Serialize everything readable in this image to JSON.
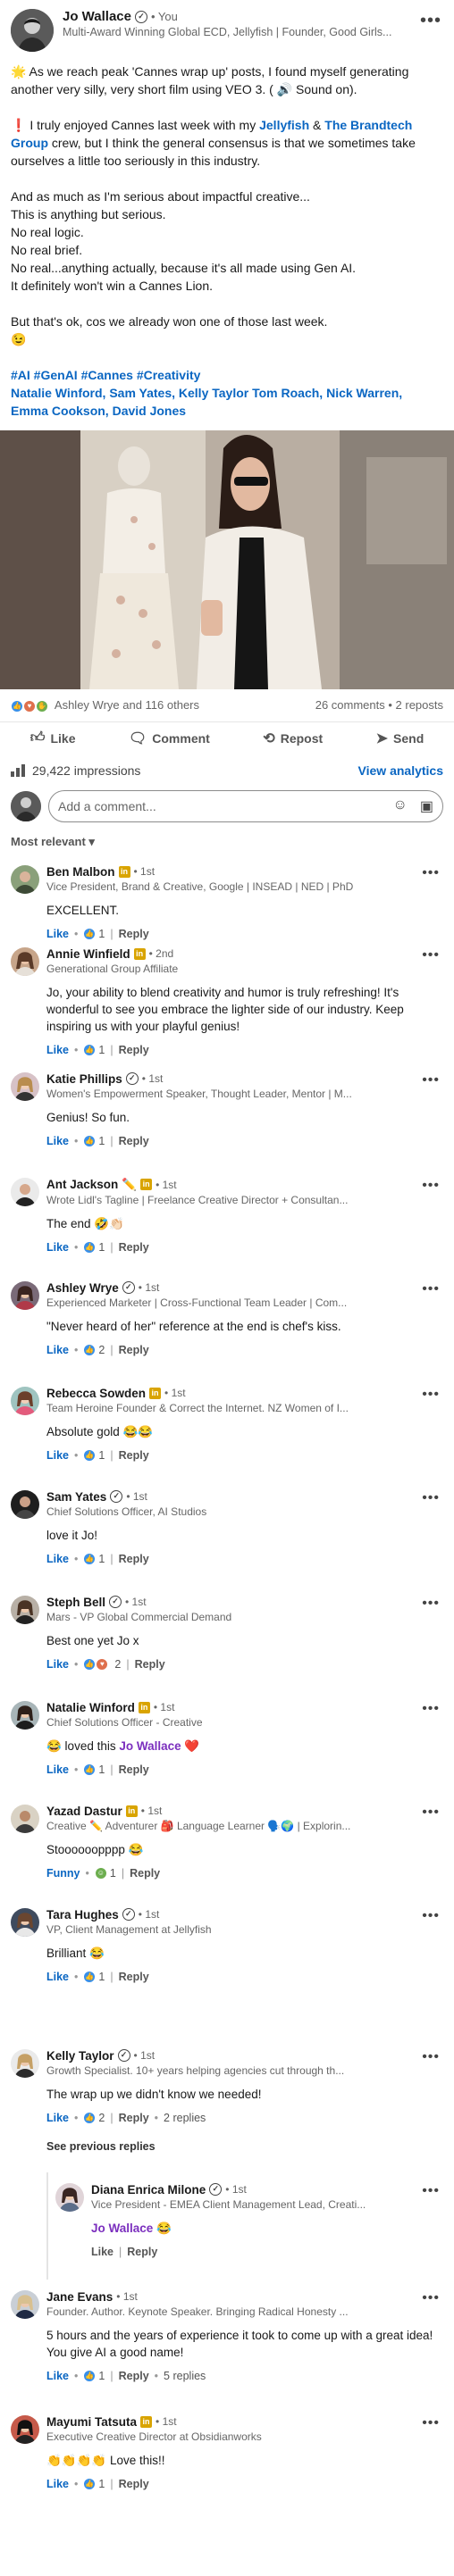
{
  "post": {
    "author_name": "Jo Wallace",
    "author_degree": "• You",
    "author_headline": "Multi-Award Winning Global ECD, Jellyfish | Founder, Good Girls...",
    "body": {
      "line1": "🌟 As we reach peak 'Cannes wrap up' posts, I found myself generating another very silly, very short film using VEO 3. ( 🔊 Sound on).",
      "line2_prefix": "❗ I truly enjoyed Cannes last week with my ",
      "link1": "Jellyfish",
      "amp": " & ",
      "link2": "The Brandtech Group",
      "line2_suffix": " crew, but I think the general consensus is that we sometimes take ourselves a little too seriously in this industry.",
      "line3": "And as much as I'm serious about impactful creative...",
      "line4": "This is anything but serious.",
      "line5": "No real logic.",
      "line6": "No real brief.",
      "line7": "No real...anything actually, because it's all made using Gen AI.",
      "line8": "It definitely won't win a Cannes Lion.",
      "line9": "But that's ok, cos we already won one of those last week.",
      "line10": "😉",
      "hashtags": "#AI #GenAI #Cannes #Creativity",
      "tags": "Natalie Winford, Sam Yates, Kelly Taylor Tom Roach, Nick Warren, Emma Cookson, David Jones"
    },
    "reactions_text": "Ashley Wrye and 116 others",
    "comments_reposts": "26 comments • 2 reposts",
    "actions": {
      "like": "Like",
      "comment": "Comment",
      "repost": "Repost",
      "send": "Send"
    },
    "impressions": "29,422 impressions",
    "view_analytics": "View analytics",
    "comment_placeholder": "Add a comment...",
    "sort_label": "Most relevant ▾"
  },
  "comments": [
    {
      "name": "Ben Malbon",
      "degree": "• 1st",
      "headline": "Vice President, Brand & Creative, Google | INSEAD | NED | PhD",
      "text": "EXCELLENT.",
      "reaction": "Like",
      "count": "1",
      "reply": "Reply"
    },
    {
      "name": "Annie Winfield",
      "degree": "• 2nd",
      "headline": "Generational Group Affiliate",
      "text": "Jo, your ability to blend creativity and humor is truly refreshing! It's wonderful to see you embrace the lighter side of our industry. Keep inspiring us with your playful genius!",
      "reaction": "Like",
      "count": "1",
      "reply": "Reply"
    },
    {
      "name": "Katie Phillips",
      "degree": "• 1st",
      "headline": "Women's Empowerment Speaker, Thought Leader, Mentor | M...",
      "text": "Genius! So fun.",
      "reaction": "Like",
      "count": "1",
      "reply": "Reply"
    },
    {
      "name": "Ant Jackson",
      "degree": "• 1st",
      "headline": "Wrote Lidl's Tagline | Freelance Creative Director + Consultan...",
      "text": "The end 🤣👏🏻",
      "reaction": "Like",
      "count": "1",
      "reply": "Reply"
    },
    {
      "name": "Ashley Wrye",
      "degree": "• 1st",
      "headline": "Experienced Marketer | Cross-Functional Team Leader | Com...",
      "text": "\"Never heard of her\" reference at the end is chef's kiss.",
      "reaction": "Like",
      "count": "2",
      "reply": "Reply"
    },
    {
      "name": "Rebecca Sowden",
      "degree": "• 1st",
      "headline": "Team Heroine Founder & Correct the Internet. NZ Women of I...",
      "text": "Absolute gold 😂😂",
      "reaction": "Like",
      "count": "1",
      "reply": "Reply"
    },
    {
      "name": "Sam Yates",
      "degree": "• 1st",
      "headline": "Chief Solutions Officer, AI Studios",
      "text": "love it Jo!",
      "reaction": "Like",
      "count": "1",
      "reply": "Reply"
    },
    {
      "name": "Steph Bell",
      "degree": "• 1st",
      "headline": "Mars - VP Global Commercial Demand",
      "text": "Best one yet Jo x",
      "reaction": "Like",
      "count": "2",
      "reply": "Reply"
    },
    {
      "name": "Natalie Winford",
      "degree": "• 1st",
      "headline": "Chief Solutions Officer - Creative",
      "text_prefix": "😂 loved this ",
      "mention": "Jo Wallace",
      "text_suffix": " ❤️",
      "reaction": "Like",
      "count": "1",
      "reply": "Reply"
    },
    {
      "name": "Yazad Dastur",
      "degree": "• 1st",
      "headline": "Creative ✏️ Adventurer 🎒 Language Learner 🗣️🌍 | Explorin...",
      "text": "Stoooooopppp 😂",
      "reaction": "Funny",
      "count": "1",
      "reply": "Reply"
    },
    {
      "name": "Tara Hughes",
      "degree": "• 1st",
      "headline": "VP, Client Management at Jellyfish",
      "text": "Brilliant 😂",
      "reaction": "Like",
      "count": "1",
      "reply": "Reply"
    },
    {
      "name": "Kelly Taylor",
      "degree": "• 1st",
      "headline": "Growth Specialist. 10+ years helping agencies cut through th...",
      "text": "The wrap up we didn't know we needed!",
      "reaction": "Like",
      "count": "2",
      "reply": "Reply",
      "replies_count": "2 replies",
      "see_previous": "See previous replies"
    },
    {
      "name": "Diana Enrica Milone",
      "degree": "• 1st",
      "headline": "Vice President - EMEA Client Management Lead, Creati...",
      "mention": "Jo Wallace",
      "text_suffix": " 😂",
      "reaction": "Like",
      "reply": "Reply"
    },
    {
      "name": "Jane Evans",
      "degree": "• 1st",
      "headline": "Founder. Author. Keynote Speaker. Bringing Radical Honesty ...",
      "text": "5 hours and the years of experience it took to come up with a great idea! You give AI a good name!",
      "reaction": "Like",
      "count": "1",
      "reply": "Reply",
      "replies_count": "5 replies"
    },
    {
      "name": "Mayumi Tatsuta",
      "degree": "• 1st",
      "headline": "Executive Creative Director at Obsidianworks",
      "text": "👏👏👏👏 Love this!!",
      "reaction": "Like",
      "count": "1",
      "reply": "Reply"
    }
  ],
  "colors": {
    "link": "#0a66c2",
    "mention": "#7b2fbe",
    "badge": "#d9a400"
  }
}
